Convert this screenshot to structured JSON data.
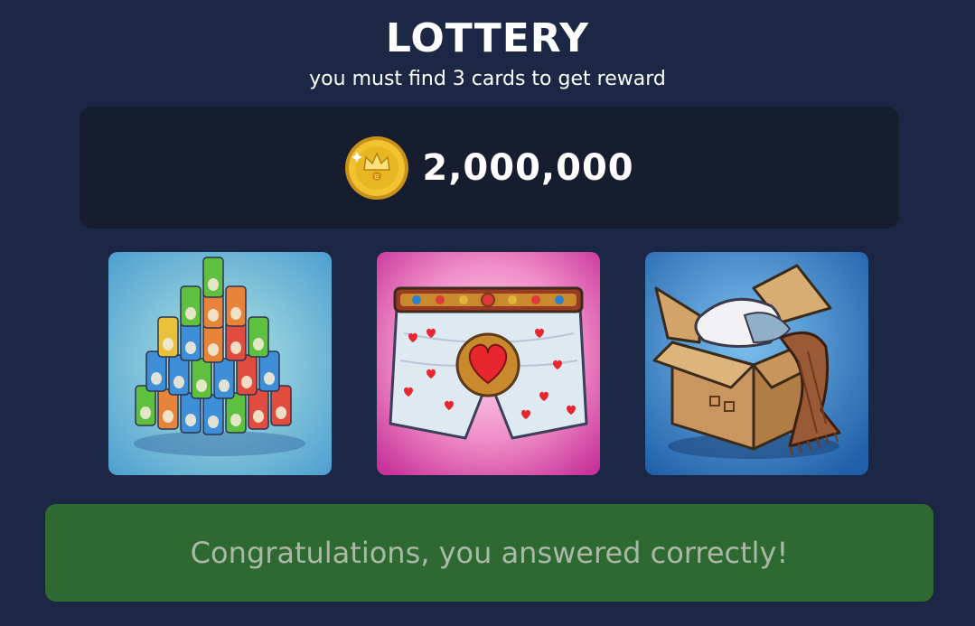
{
  "header": {
    "title": "LOTTERY",
    "subtitle": "you must find 3 cards to get reward"
  },
  "reward": {
    "icon": "coin-icon",
    "amount": "2,000,000"
  },
  "cards": [
    {
      "name": "soda-cans-pyramid",
      "icon": "soda-cans-card-image"
    },
    {
      "name": "heart-boxer-shorts",
      "icon": "boxer-shorts-card-image"
    },
    {
      "name": "cardboard-box-with-pillow-and-scarf",
      "icon": "cardboard-box-card-image"
    }
  ],
  "result": {
    "message": "Congratulations, you answered correctly!"
  },
  "colors": {
    "background": "#1b2744",
    "panel": "#161d2f",
    "banner": "#2f6932",
    "banner_text": "#a9b9a5",
    "coin": "#f2c230"
  }
}
